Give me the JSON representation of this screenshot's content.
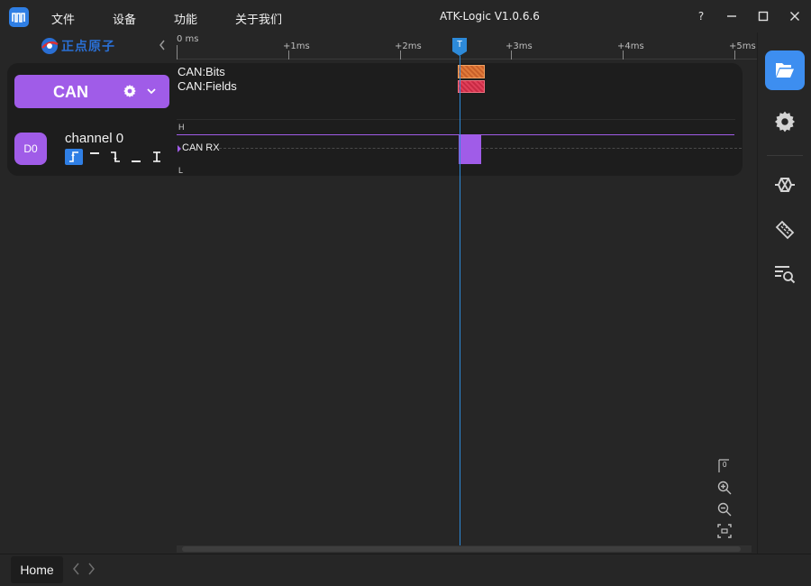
{
  "menu": {
    "file": "文件",
    "device": "设备",
    "function": "功能",
    "about": "关于我们"
  },
  "window": {
    "title": "ATK-Logic  V1.0.6.6",
    "help": "?",
    "minimize": "—",
    "close": "✕"
  },
  "brand": {
    "text": "正点原子"
  },
  "ruler": {
    "origin": "0 ms",
    "ticks": [
      "+1ms",
      "+2ms",
      "+3ms",
      "+4ms",
      "+5ms"
    ],
    "trigger_label": "T"
  },
  "decoder": {
    "name": "CAN",
    "rows": [
      "CAN:Bits",
      "CAN:Fields"
    ]
  },
  "channel": {
    "badge": "D0",
    "name": "channel 0",
    "signal_label": "CAN RX",
    "high_label": "H",
    "low_label": "L"
  },
  "zoom": {
    "reset_label": "0"
  },
  "bottom": {
    "home_tab": "Home",
    "back": "‹",
    "forward": "›"
  },
  "colors": {
    "accent_purple": "#a05ce8",
    "accent_blue": "#3d8ef0",
    "trigger_blue": "#2d8ad9",
    "bits_orange": "#e07a3a",
    "fields_red": "#e0405a"
  }
}
